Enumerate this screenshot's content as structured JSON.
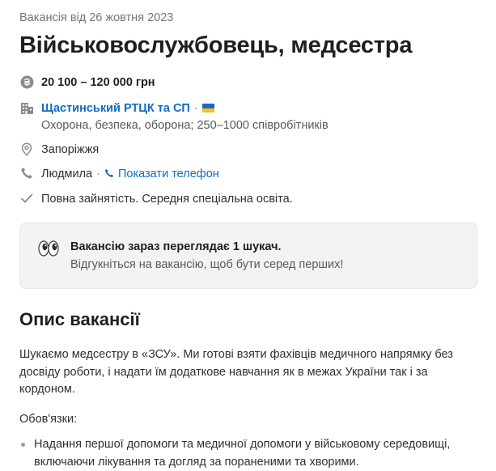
{
  "vacancy": {
    "date_line": "Вакансія від 26 жовтня 2023",
    "title": "Військовослужбовець, медсестра",
    "salary": "20 100 – 120 000 грн",
    "company_name": "Щастинський РТЦК та СП",
    "company_separator": "·",
    "company_details": "Охорона, безпека, оборона; 250–1000 співробітників",
    "location": "Запоріжжя",
    "contact_name": "Людмила",
    "contact_separator": "·",
    "show_phone_label": "Показати телефон",
    "employment": "Повна зайнятість. Середня спеціальна освіта."
  },
  "viewers": {
    "title": "Вакансію зараз переглядає 1 шукач.",
    "subtitle": "Відгукніться на вакансію, щоб бути серед перших!"
  },
  "description": {
    "heading": "Опис вакансії",
    "intro": "Шукаємо медсестру в «ЗСУ». Ми готові взяти фахівців медичного напрямку без досвіду роботи, і надати їм додаткове навчання як в межах України так і за кордоном.",
    "duties_heading": "Обов'язки:",
    "duties": [
      "Надання першої допомоги та медичної допомоги у військовому середовищі, включаючи лікування та догляд за пораненими та хворими."
    ]
  },
  "icons": {
    "salary": "hryvnia-coin-icon",
    "company": "building-icon",
    "flag": "ukraine-flag-icon",
    "location": "map-pin-icon",
    "phone": "phone-icon",
    "employment": "checkmark-icon",
    "viewers": "eyes-icon"
  },
  "colors": {
    "link": "#0f6bc4",
    "text": "#303030",
    "muted": "#595959",
    "card_bg": "#f2f3f5",
    "icon_gray": "#8c8c8c"
  }
}
